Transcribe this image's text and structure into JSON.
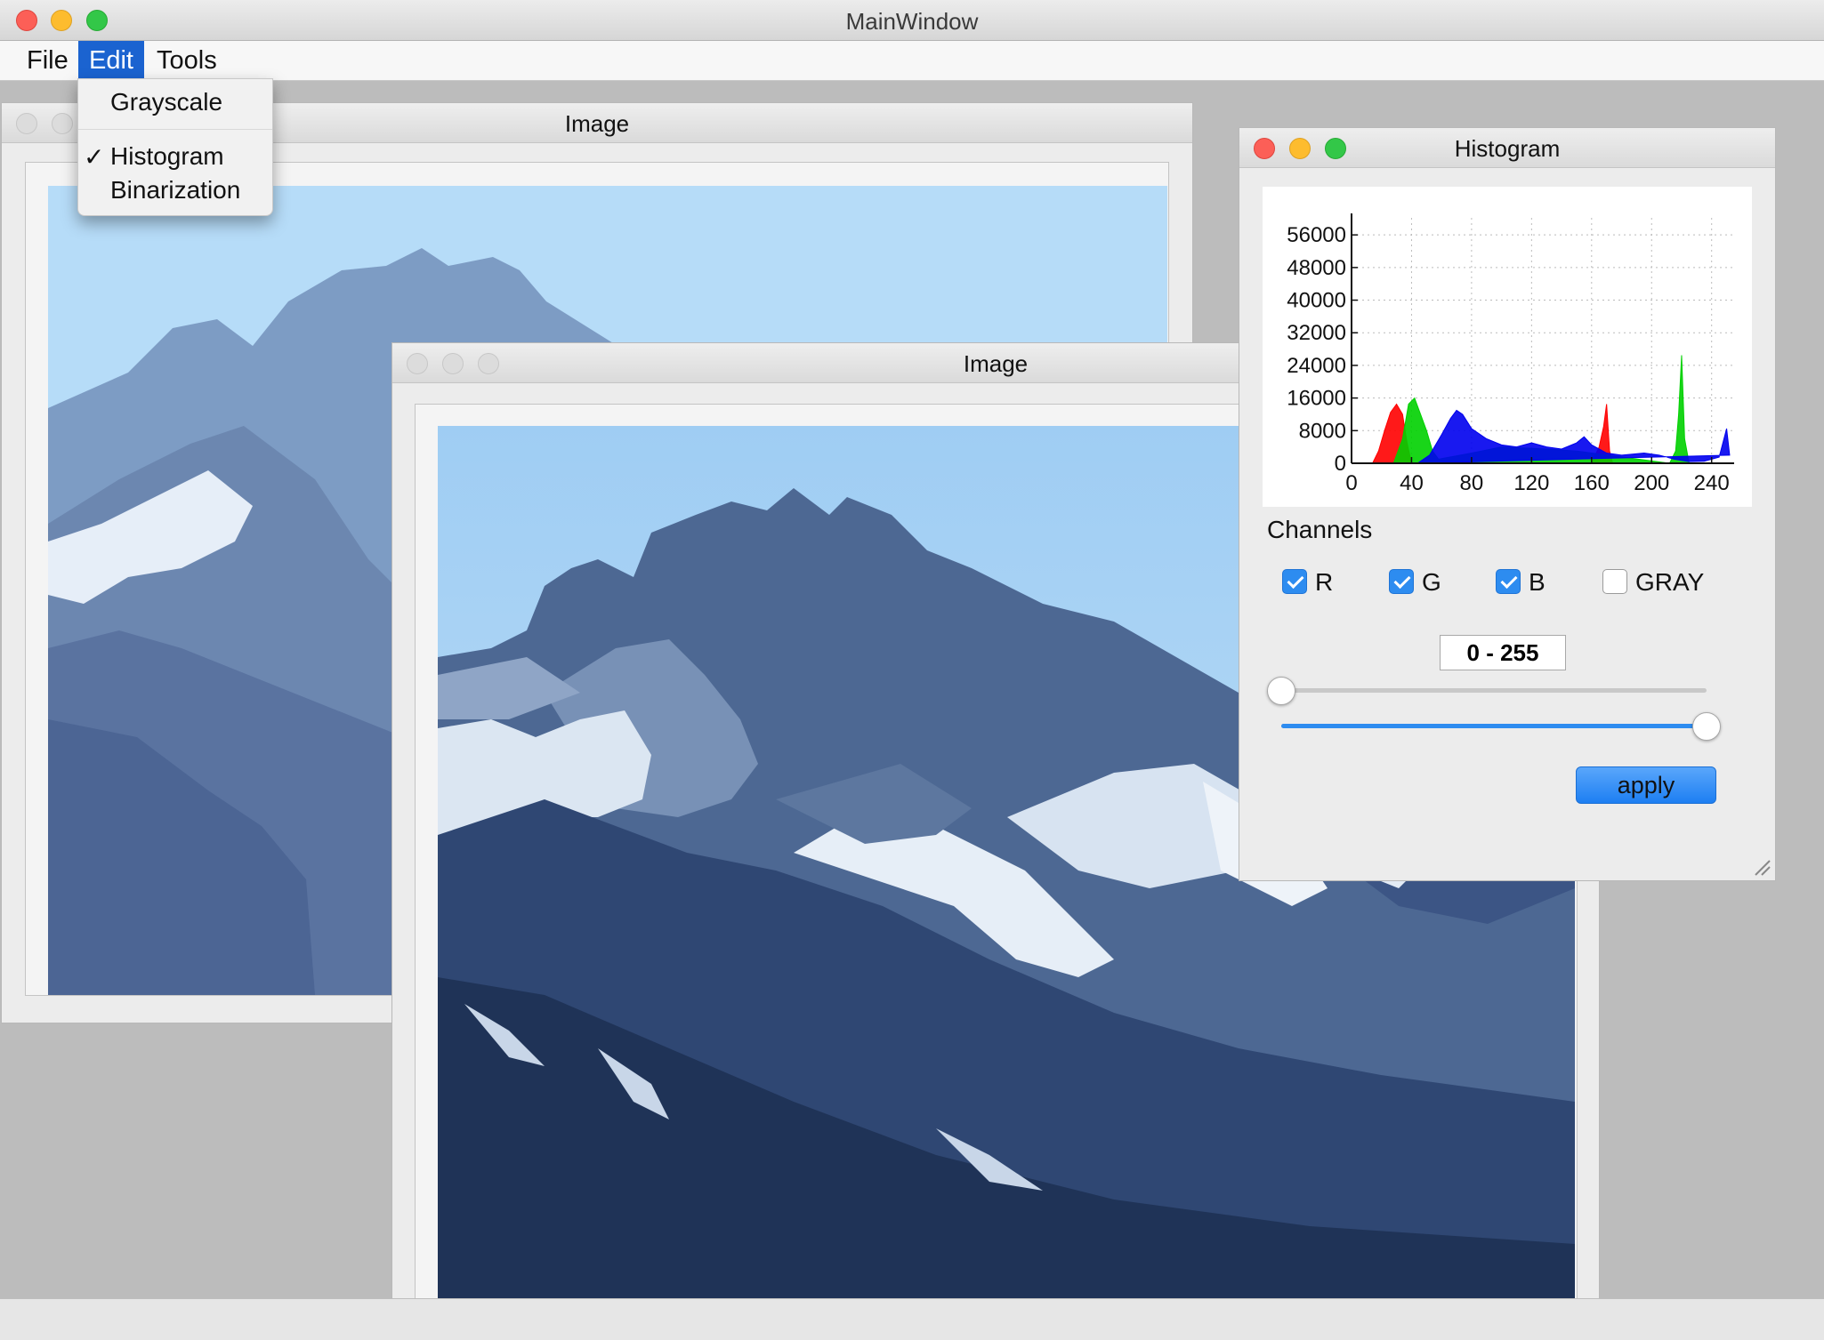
{
  "main_window": {
    "title": "MainWindow"
  },
  "menubar": {
    "items": [
      {
        "label": "File"
      },
      {
        "label": "Edit"
      },
      {
        "label": "Tools"
      }
    ]
  },
  "edit_menu": {
    "items": [
      {
        "label": "Grayscale",
        "checked": false
      },
      {
        "label": "Histogram",
        "checked": true
      },
      {
        "label": "Binarization",
        "checked": false
      }
    ],
    "check_glyph": "✓"
  },
  "image_window_back": {
    "title": "Image"
  },
  "image_window_front": {
    "title": "Image"
  },
  "histogram_window": {
    "title": "Histogram",
    "channels_label": "Channels",
    "channels": [
      {
        "label": "R",
        "checked": true
      },
      {
        "label": "G",
        "checked": true
      },
      {
        "label": "B",
        "checked": true
      },
      {
        "label": "GRAY",
        "checked": false
      }
    ],
    "range_text": "0 - 255",
    "slider_min": {
      "value": 0,
      "max": 255
    },
    "slider_max": {
      "value": 255,
      "max": 255
    },
    "apply_label": "apply"
  },
  "chart_data": {
    "type": "area",
    "x_ticks": [
      0,
      40,
      80,
      120,
      160,
      200,
      240
    ],
    "y_ticks": [
      0,
      8000,
      16000,
      24000,
      32000,
      40000,
      48000,
      56000
    ],
    "xlim": [
      0,
      255
    ],
    "ylim": [
      0,
      58000
    ],
    "grid": true,
    "series": [
      {
        "color": "#ff0000",
        "points": [
          [
            14,
            0
          ],
          [
            18,
            3000
          ],
          [
            22,
            8000
          ],
          [
            26,
            12500
          ],
          [
            30,
            14500
          ],
          [
            34,
            12000
          ],
          [
            37,
            5000
          ],
          [
            40,
            0
          ],
          [
            160,
            0
          ],
          [
            165,
            4000
          ],
          [
            168,
            9000
          ],
          [
            170,
            14500
          ],
          [
            172,
            3000
          ],
          [
            174,
            0
          ]
        ]
      },
      {
        "color": "#00d000",
        "points": [
          [
            28,
            0
          ],
          [
            34,
            6000
          ],
          [
            38,
            14500
          ],
          [
            42,
            16000
          ],
          [
            46,
            12000
          ],
          [
            50,
            8000
          ],
          [
            54,
            3000
          ],
          [
            58,
            1000
          ],
          [
            80,
            2500
          ],
          [
            100,
            4000
          ],
          [
            130,
            3500
          ],
          [
            150,
            3000
          ],
          [
            212,
            0
          ],
          [
            216,
            3000
          ],
          [
            218,
            12000
          ],
          [
            220,
            26500
          ],
          [
            222,
            6000
          ],
          [
            225,
            0
          ]
        ]
      },
      {
        "color": "#0000ee",
        "points": [
          [
            44,
            0
          ],
          [
            52,
            2000
          ],
          [
            60,
            7000
          ],
          [
            66,
            11000
          ],
          [
            70,
            13000
          ],
          [
            74,
            12000
          ],
          [
            80,
            8500
          ],
          [
            90,
            6000
          ],
          [
            100,
            4500
          ],
          [
            110,
            4000
          ],
          [
            120,
            5000
          ],
          [
            130,
            4000
          ],
          [
            140,
            3500
          ],
          [
            150,
            5000
          ],
          [
            155,
            6500
          ],
          [
            160,
            4500
          ],
          [
            170,
            2500
          ],
          [
            180,
            2000
          ],
          [
            195,
            2500
          ],
          [
            205,
            2000
          ],
          [
            215,
            1000
          ],
          [
            225,
            400
          ],
          [
            235,
            500
          ],
          [
            245,
            1500
          ],
          [
            250,
            8500
          ],
          [
            252,
            2000
          ]
        ]
      }
    ]
  },
  "colors": {
    "menu_highlight": "#1b63d0",
    "accent": "#2d8cf0",
    "sky": "#aed6f7",
    "mountain": "#3f5c8c"
  }
}
